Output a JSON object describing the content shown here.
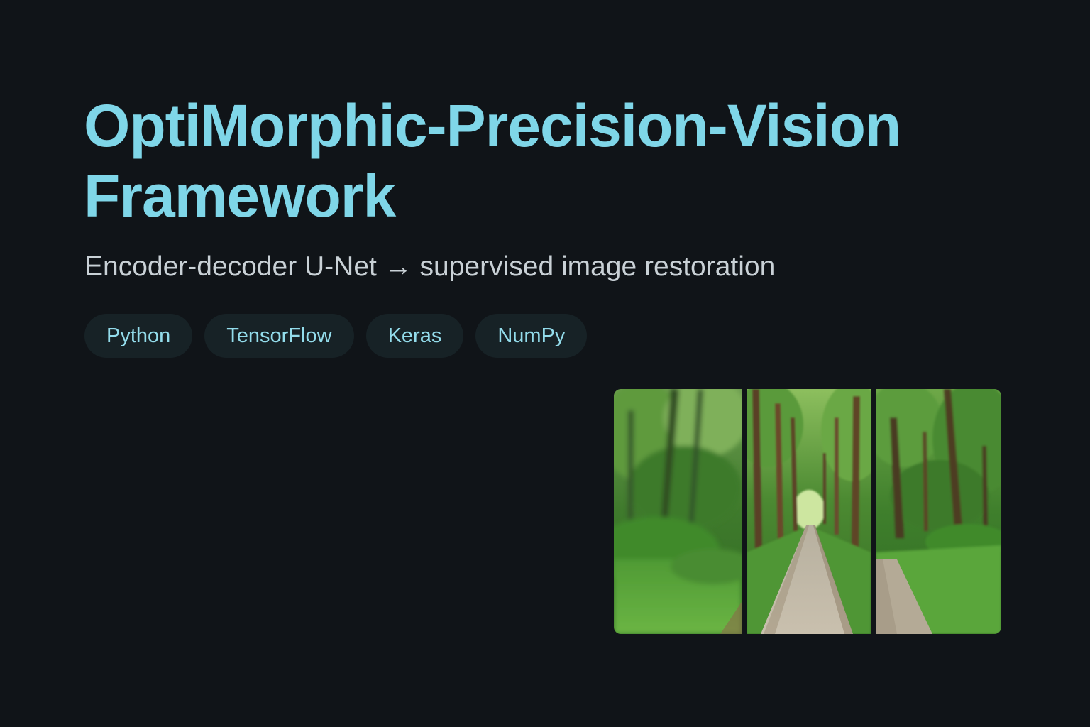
{
  "header": {
    "title": "OptiMorphic-Precision-Vision Framework",
    "subtitle": "Encoder-decoder U-Net → supervised image restoration"
  },
  "tags": [
    "Python",
    "TensorFlow",
    "Keras",
    "NumPy"
  ],
  "preview": {
    "panels": [
      {
        "name": "blurred-forest-panel",
        "kind": "forest-blurred"
      },
      {
        "name": "forest-path-panel",
        "kind": "forest-path"
      },
      {
        "name": "restored-forest-panel",
        "kind": "forest-sharp"
      }
    ]
  },
  "colors": {
    "background": "#101418",
    "title": "#7fd6e8",
    "subtitle": "#c9d1d6",
    "tag_bg": "#172226",
    "tag_text": "#93dceb"
  }
}
